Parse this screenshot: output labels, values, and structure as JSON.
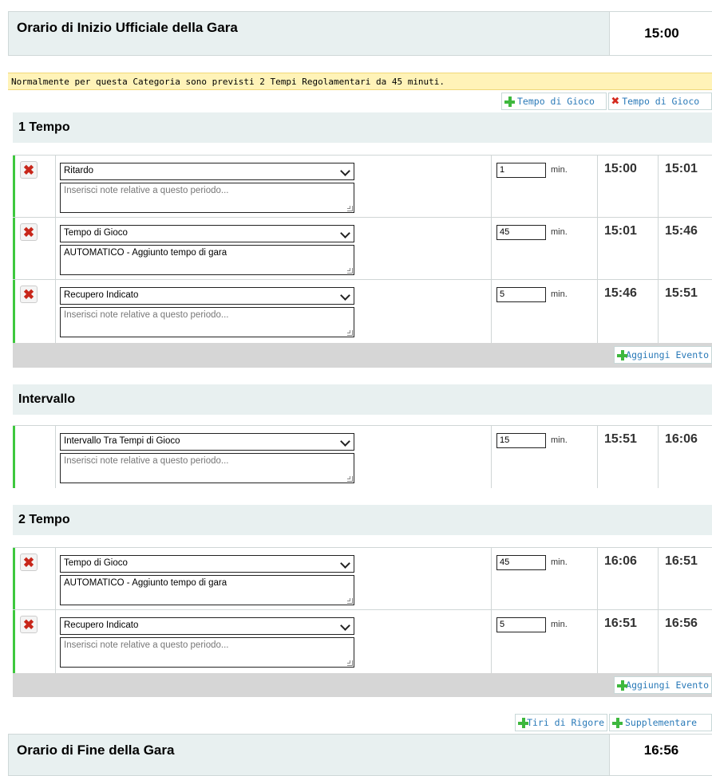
{
  "official_start": {
    "label": "Orario di Inizio Ufficiale della Gara",
    "time": "15:00"
  },
  "notice": "Normalmente per questa Categoria sono previsti 2 Tempi Regolamentari da 45 minuti.",
  "top_actions": {
    "add_play_time": "Tempo di Gioco",
    "remove_play_time": "Tempo di Gioco"
  },
  "note_placeholder": "Inserisci note relative a questo periodo...",
  "unit": "min.",
  "sections": [
    {
      "title": "1 Tempo",
      "add_event": "Aggiungi Evento",
      "events": [
        {
          "type": "Ritardo",
          "note": "",
          "minutes": "1",
          "start": "15:00",
          "end": "15:01"
        },
        {
          "type": "Tempo di Gioco",
          "note": "AUTOMATICO - Aggiunto tempo di gara",
          "minutes": "45",
          "start": "15:01",
          "end": "15:46"
        },
        {
          "type": "Recupero Indicato",
          "note": "",
          "minutes": "5",
          "start": "15:46",
          "end": "15:51"
        }
      ]
    },
    {
      "title": "Intervallo",
      "events": [
        {
          "type": "Intervallo Tra Tempi di Gioco",
          "note": "",
          "minutes": "15",
          "start": "15:51",
          "end": "16:06"
        }
      ]
    },
    {
      "title": "2 Tempo",
      "add_event": "Aggiungi Evento",
      "events": [
        {
          "type": "Tempo di Gioco",
          "note": "AUTOMATICO - Aggiunto tempo di gara",
          "minutes": "45",
          "start": "16:06",
          "end": "16:51"
        },
        {
          "type": "Recupero Indicato",
          "note": "",
          "minutes": "5",
          "start": "16:51",
          "end": "16:56"
        }
      ]
    }
  ],
  "bottom_actions": {
    "penalties": "Tiri di Rigore",
    "extra_time": "Supplementare"
  },
  "end_time": {
    "label": "Orario di Fine della Gara",
    "time": "16:56"
  },
  "colors": {
    "header_bg": "#e8f0f0",
    "notice_bg": "#fff3b8",
    "accent_green": "#3ec83e",
    "link_blue": "#2a7ab8",
    "delete_red": "#c8261a"
  }
}
